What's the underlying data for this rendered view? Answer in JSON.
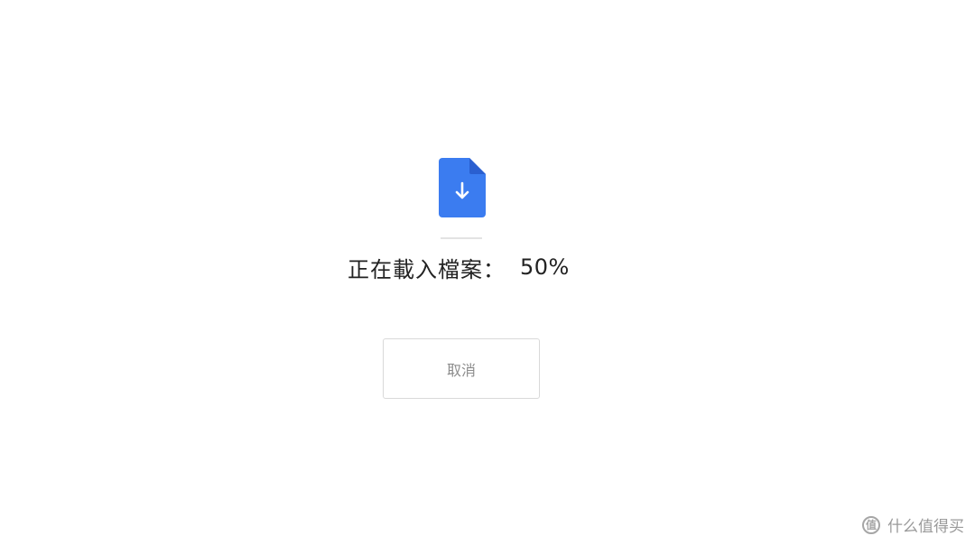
{
  "loading": {
    "icon": "file-download-icon",
    "status_label": "正在載入檔案：",
    "progress_text": "50%",
    "progress_fraction": 0.5
  },
  "actions": {
    "cancel_label": "取消"
  },
  "watermark": {
    "logo_glyph": "值",
    "text": "什么值得买"
  },
  "colors": {
    "icon_blue": "#3b7cf0",
    "icon_fold": "#2a5fd0",
    "background": "#ffffff",
    "button_text": "#8c8c8c"
  }
}
